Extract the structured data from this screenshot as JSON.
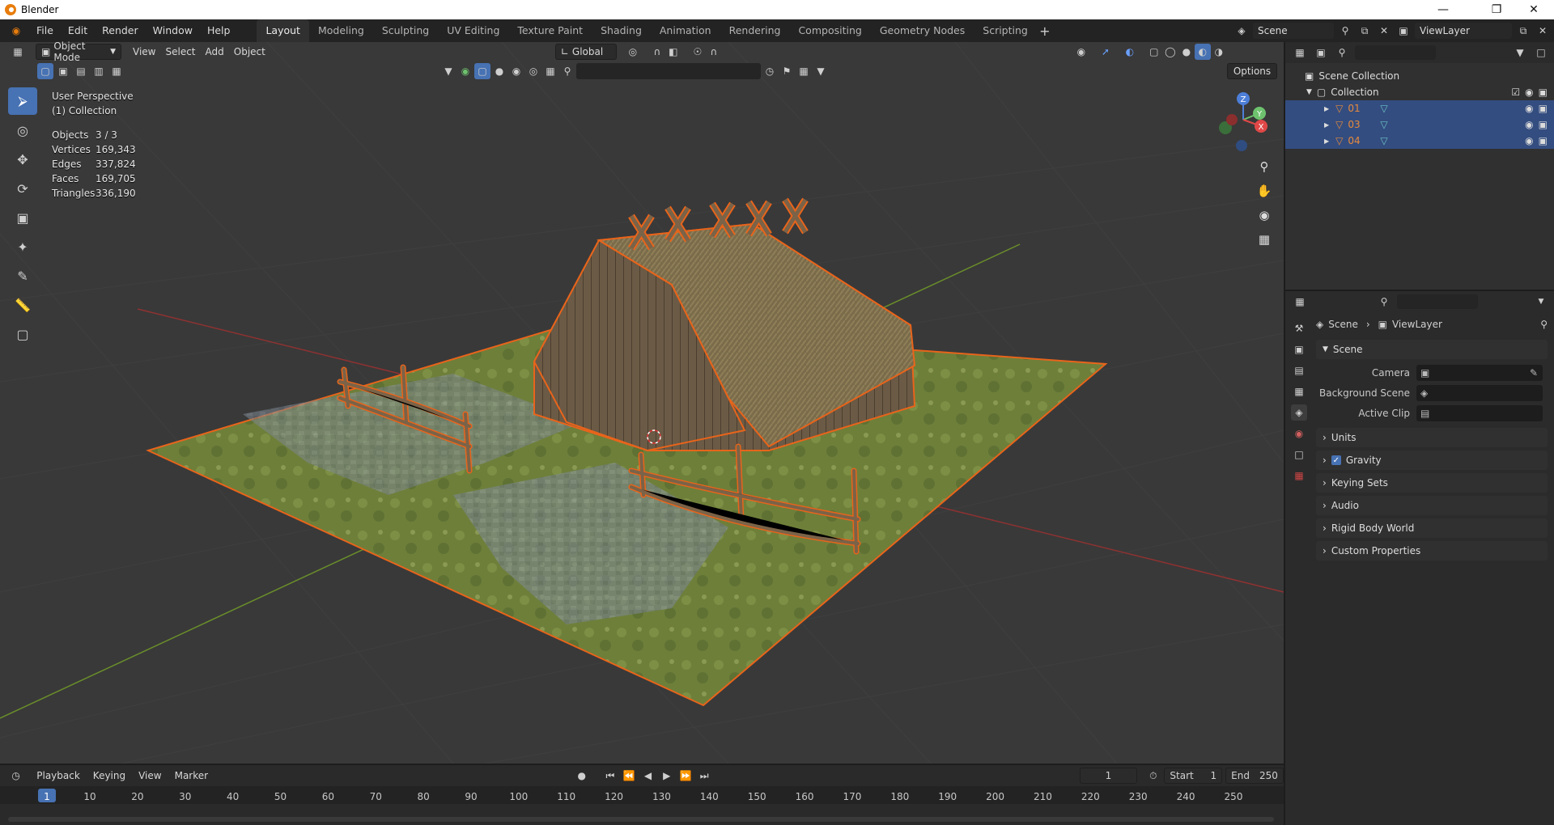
{
  "window": {
    "title": "Blender",
    "controls": [
      "minimize-icon",
      "restore-icon",
      "close-icon"
    ]
  },
  "menu": [
    "File",
    "Edit",
    "Render",
    "Window",
    "Help"
  ],
  "workspaces": [
    "Layout",
    "Modeling",
    "Sculpting",
    "UV Editing",
    "Texture Paint",
    "Shading",
    "Animation",
    "Rendering",
    "Compositing",
    "Geometry Nodes",
    "Scripting"
  ],
  "active_workspace": "Layout",
  "scene_selector": {
    "value": "Scene"
  },
  "viewlayer_selector": {
    "value": "ViewLayer"
  },
  "viewport_header": {
    "mode": "Object Mode",
    "menus": [
      "View",
      "Select",
      "Add",
      "Object"
    ],
    "orientation": "Global",
    "options": "Options"
  },
  "viewport_overlay": {
    "perspective": "User Perspective",
    "collection": "(1) Collection",
    "stats": [
      {
        "label": "Objects",
        "value": "3 / 3"
      },
      {
        "label": "Vertices",
        "value": "169,343"
      },
      {
        "label": "Edges",
        "value": "337,824"
      },
      {
        "label": "Faces",
        "value": "169,705"
      },
      {
        "label": "Triangles",
        "value": "336,190"
      }
    ]
  },
  "gizmo_axes": [
    "Z",
    "Y",
    "X"
  ],
  "outliner": {
    "root": "Scene Collection",
    "collection": "Collection",
    "objects": [
      "01",
      "03",
      "04"
    ]
  },
  "properties": {
    "breadcrumb": [
      "Scene",
      "ViewLayer"
    ],
    "panel_title": "Scene",
    "fields": [
      {
        "label": "Camera"
      },
      {
        "label": "Background Scene"
      },
      {
        "label": "Active Clip"
      }
    ],
    "collapsed_panels": [
      "Units",
      "Gravity",
      "Keying Sets",
      "Audio",
      "Rigid Body World",
      "Custom Properties"
    ],
    "gravity_checked": true
  },
  "timeline": {
    "menus": [
      "Playback",
      "Keying",
      "View",
      "Marker"
    ],
    "current_frame": "1",
    "start_label": "Start",
    "start_value": "1",
    "end_label": "End",
    "end_value": "250",
    "ruler": [
      "1",
      "10",
      "20",
      "30",
      "40",
      "50",
      "60",
      "70",
      "80",
      "90",
      "100",
      "110",
      "120",
      "130",
      "140",
      "150",
      "160",
      "170",
      "180",
      "190",
      "200",
      "210",
      "220",
      "230",
      "240",
      "250"
    ]
  },
  "colors": {
    "accent": "#4772b3",
    "selection_outline": "#e8641b",
    "active_object": "#e88a3c"
  }
}
